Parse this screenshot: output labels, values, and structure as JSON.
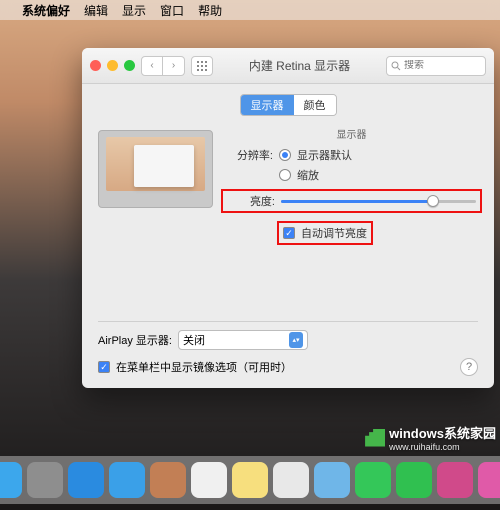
{
  "menubar": {
    "app": "系统偏好",
    "items": [
      "编辑",
      "显示",
      "窗口",
      "帮助"
    ]
  },
  "window": {
    "title": "内建 Retina 显示器",
    "search_placeholder": "搜索",
    "tabs": {
      "display": "显示器",
      "color": "颜色"
    },
    "settings": {
      "header": "显示器",
      "resolution_label": "分辨率:",
      "resolution_default": "显示器默认",
      "resolution_scaled": "缩放",
      "brightness_label": "亮度:",
      "brightness_value": 78,
      "auto_brightness": "自动调节亮度"
    },
    "airplay": {
      "label": "AirPlay 显示器:",
      "value": "关闭"
    },
    "mirror_checkbox": "在菜单栏中显示镜像选项（可用时）"
  },
  "watermark": {
    "brand": "windows",
    "sub": "系统家园",
    "url": "www.ruihaifu.com"
  },
  "colors": {
    "accent": "#4f95e8",
    "highlight": "#e11"
  },
  "dock_apps": [
    {
      "name": "finder",
      "color": "#3ca7ec"
    },
    {
      "name": "launchpad",
      "color": "#8e8e8e"
    },
    {
      "name": "safari",
      "color": "#2a8be0"
    },
    {
      "name": "mail",
      "color": "#3aa0e8"
    },
    {
      "name": "contacts",
      "color": "#c27f55"
    },
    {
      "name": "calendar",
      "color": "#f0f0f0"
    },
    {
      "name": "notes",
      "color": "#f7df7e"
    },
    {
      "name": "reminders",
      "color": "#e8e8e8"
    },
    {
      "name": "maps",
      "color": "#6fb6e8"
    },
    {
      "name": "messages",
      "color": "#34c759"
    },
    {
      "name": "facetime",
      "color": "#30c050"
    },
    {
      "name": "photo-booth",
      "color": "#d04a8a"
    },
    {
      "name": "itunes",
      "color": "#e05aa8"
    }
  ]
}
